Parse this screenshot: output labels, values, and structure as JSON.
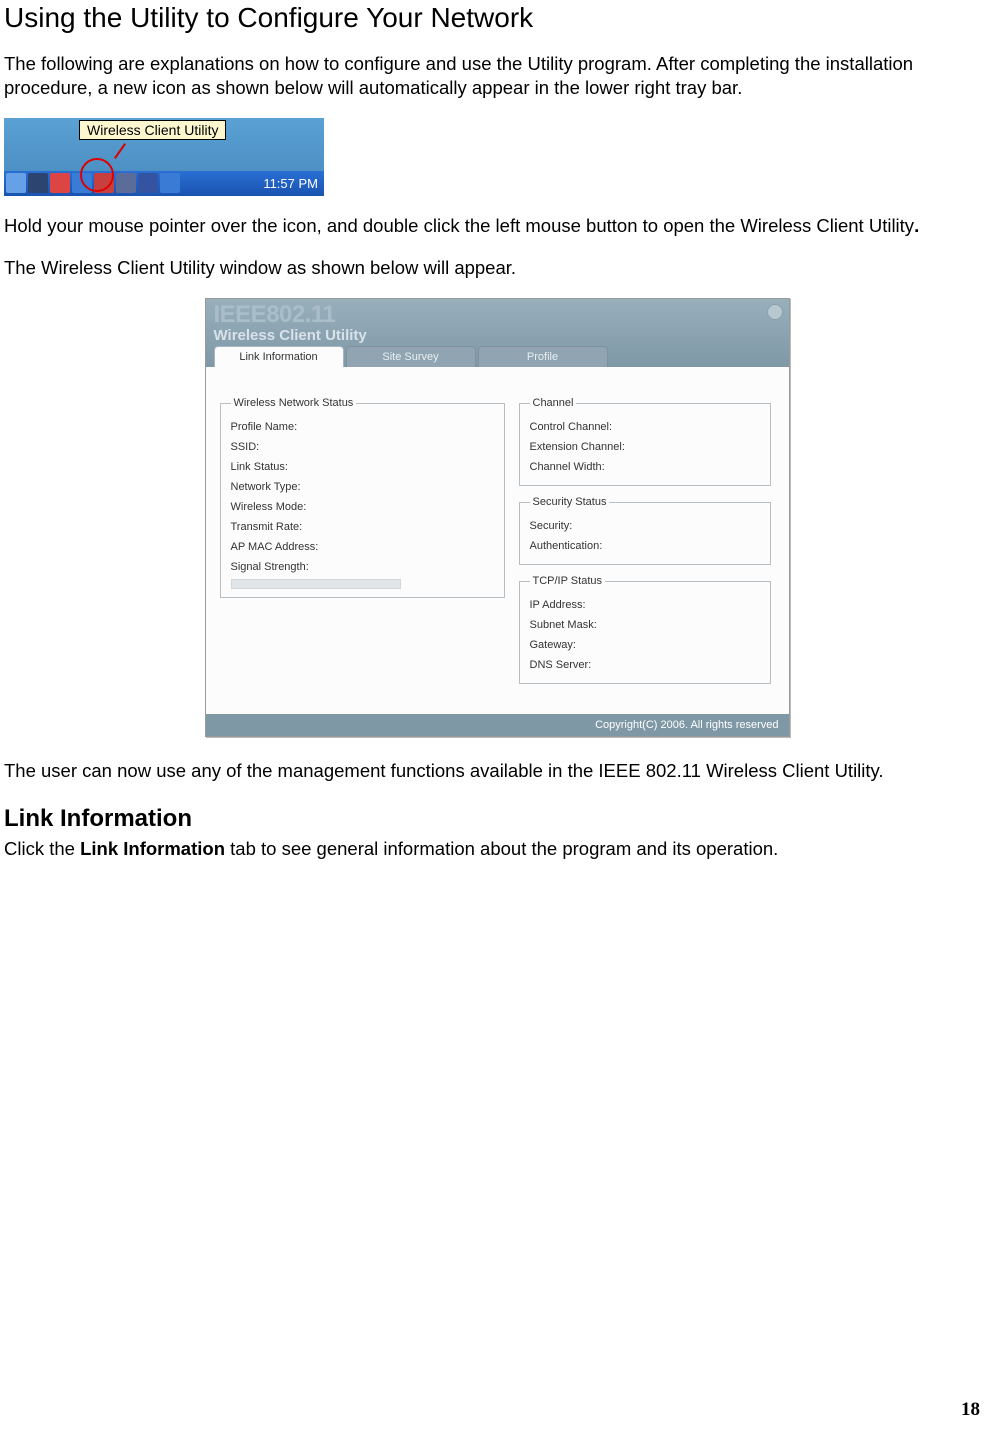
{
  "doc": {
    "title": "Using the Utility to Configure Your Network",
    "para1": "The following are explanations on how to configure and use the Utility program. After completing the installation procedure, a new icon as shown below will automatically appear in the lower right tray bar.",
    "para2_a": "Hold your mouse pointer over the icon, and double click the left mouse button to open the Wireless Client Utility",
    "para2_b": ".",
    "para3": "The Wireless Client Utility window as shown below will appear.",
    "para4": "The user can now use any of the management functions available in the IEEE 802.11 Wireless Client Utility.",
    "section_title": "Link Information",
    "para5_a": "Click the ",
    "para5_b": "Link Information",
    "para5_c": " tab to see general information about the program and its operation.",
    "page_number": "18"
  },
  "tray": {
    "tooltip": "Wireless Client Utility",
    "time": "11:57 PM"
  },
  "app": {
    "header_line1": "IEEE802.11",
    "header_line2": "Wireless Client Utility",
    "tabs": {
      "t1": "Link Information",
      "t2": "Site Survey",
      "t3": "Profile"
    },
    "groups": {
      "wns": {
        "legend": "Wireless Network Status",
        "f1": "Profile Name:",
        "f2": "SSID:",
        "f3": "Link Status:",
        "f4": "Network Type:",
        "f5": "Wireless Mode:",
        "f6": "Transmit Rate:",
        "f7": "AP MAC Address:",
        "f8": "Signal Strength:"
      },
      "channel": {
        "legend": "Channel",
        "f1": "Control Channel:",
        "f2": "Extension Channel:",
        "f3": "Channel Width:"
      },
      "security": {
        "legend": "Security Status",
        "f1": "Security:",
        "f2": "Authentication:"
      },
      "tcpip": {
        "legend": "TCP/IP Status",
        "f1": "IP Address:",
        "f2": "Subnet Mask:",
        "f3": "Gateway:",
        "f4": "DNS Server:"
      }
    },
    "footer": "Copyright(C) 2006. All rights reserved"
  }
}
